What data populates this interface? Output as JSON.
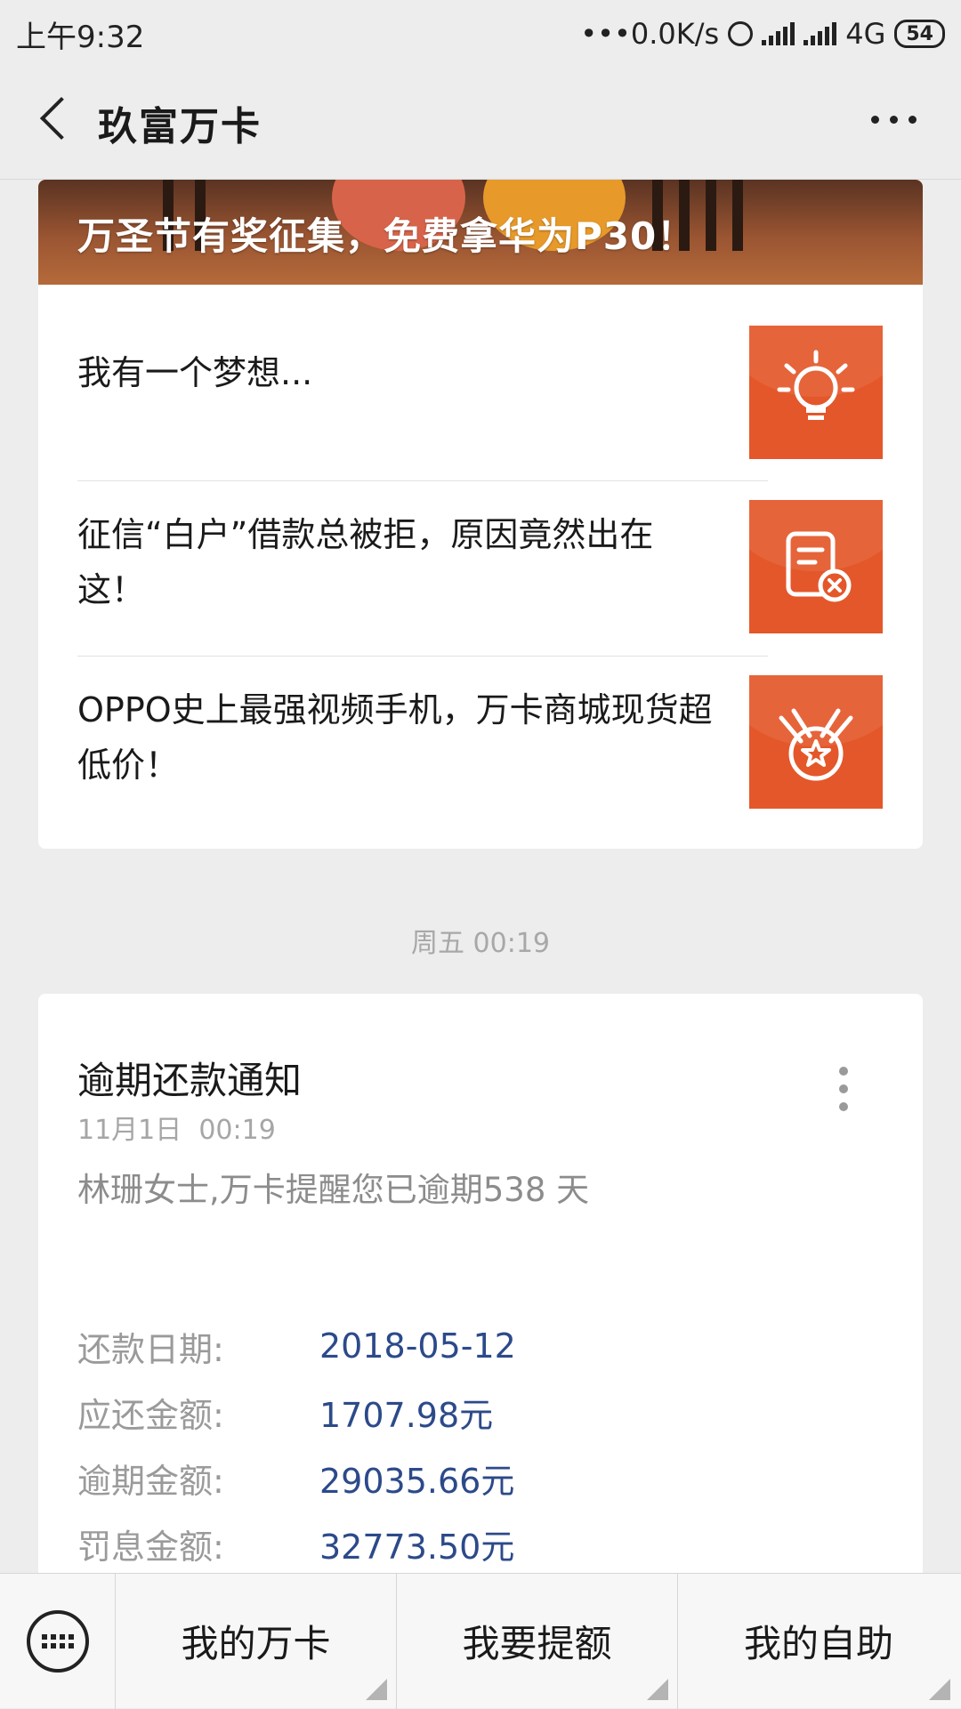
{
  "status_bar": {
    "time": "上午9:32",
    "net_speed": "•••0.0K/s",
    "network": "4G",
    "battery": "54"
  },
  "nav": {
    "title": "玖富万卡"
  },
  "articles": {
    "banner_title": "万圣节有奖征集，免费拿华为P30！",
    "items": [
      {
        "title": "我有一个梦想...",
        "icon": "lightbulb-icon"
      },
      {
        "title": "征信“白户”借款总被拒，原因竟然出在这！",
        "icon": "document-reject-icon"
      },
      {
        "title": "OPPO史上最强视频手机，万卡商城现货超低价！",
        "icon": "medal-icon"
      }
    ],
    "thumb_color": "#e4572a"
  },
  "timestamp": "周五 00:19",
  "notice": {
    "title": "逾期还款通知",
    "date": "11月1日  00:19",
    "description": "林珊女士,万卡提醒您已逾期538 天",
    "rows": [
      {
        "label": "还款日期:",
        "value": "2018-05-12"
      },
      {
        "label": "应还金额:",
        "value": "1707.98元"
      },
      {
        "label": "逾期金额:",
        "value": "29035.66元"
      },
      {
        "label": "罚息金额:",
        "value": "32773.50元"
      }
    ],
    "value_color": "#2c4a8a"
  },
  "bottom_menu": {
    "items": [
      {
        "label": "我的万卡"
      },
      {
        "label": "我要提额"
      },
      {
        "label": "我的自助"
      }
    ]
  }
}
